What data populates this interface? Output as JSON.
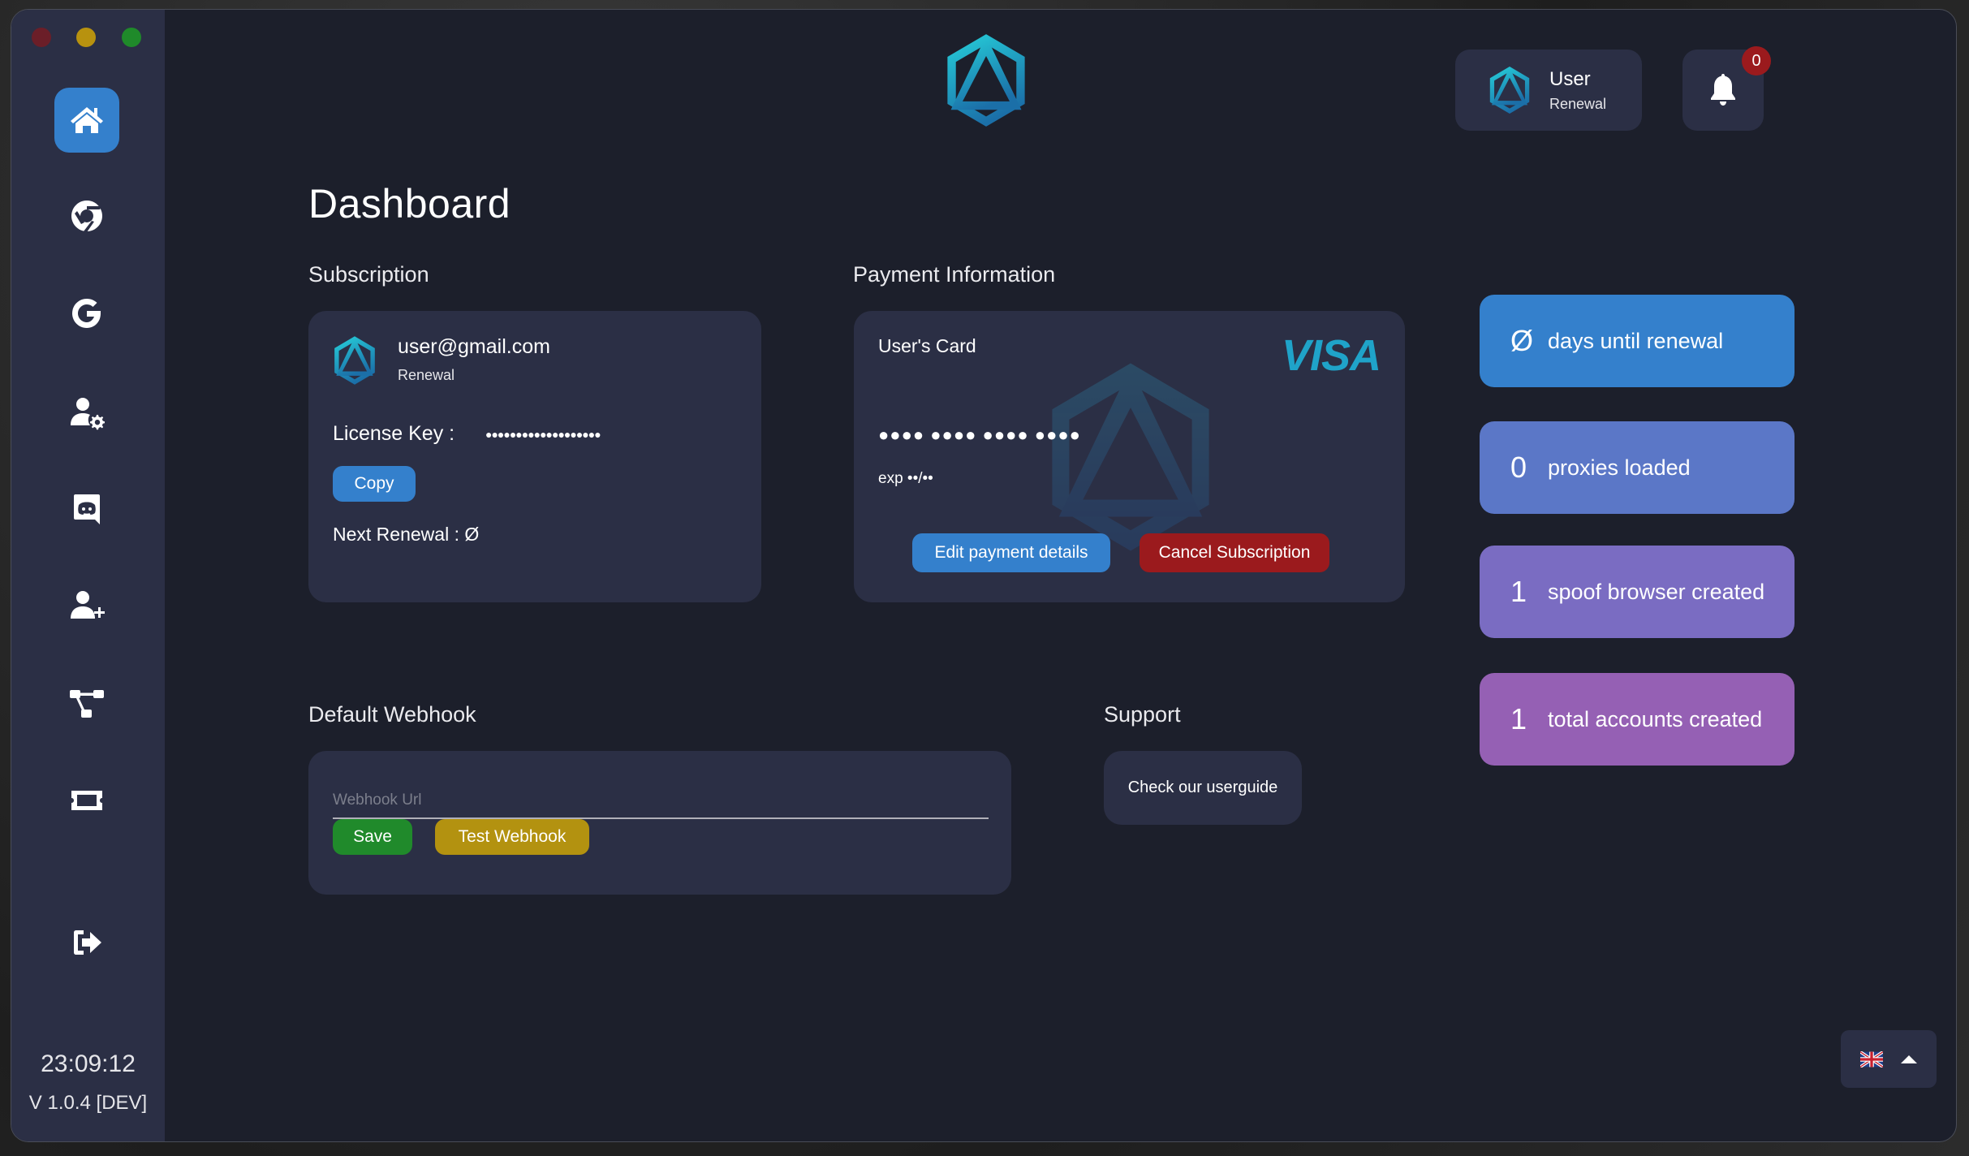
{
  "window": {
    "controls": [
      "close",
      "minimize",
      "maximize"
    ]
  },
  "sidebar": {
    "items": [
      {
        "id": "home",
        "icon": "home-icon",
        "active": true
      },
      {
        "id": "browser",
        "icon": "chrome-icon",
        "active": false
      },
      {
        "id": "google",
        "icon": "google-icon",
        "active": false
      },
      {
        "id": "account-settings",
        "icon": "user-gear-icon",
        "active": false
      },
      {
        "id": "discord",
        "icon": "discord-icon",
        "active": false
      },
      {
        "id": "add-user",
        "icon": "user-plus-icon",
        "active": false
      },
      {
        "id": "workflow",
        "icon": "sitemap-icon",
        "active": false
      },
      {
        "id": "ticket",
        "icon": "ticket-icon",
        "active": false
      },
      {
        "id": "logout",
        "icon": "logout-icon",
        "active": false
      }
    ],
    "time": "23:09:12",
    "version": "V 1.0.4 [DEV]"
  },
  "header": {
    "user": {
      "name": "User",
      "plan": "Renewal"
    },
    "notifications": {
      "count": "0"
    }
  },
  "page": {
    "title": "Dashboard"
  },
  "subscription": {
    "label": "Subscription",
    "email": "user@gmail.com",
    "plan": "Renewal",
    "license_label": "License Key :",
    "license_value": "●●●●●●●●●●●●●●●●●●●",
    "copy_label": "Copy",
    "next_renewal": "Next Renewal : Ø"
  },
  "payment": {
    "label": "Payment Information",
    "card_title": "User's Card",
    "brand": "VISA",
    "card_number": "●●●● ●●●● ●●●● ●●●●",
    "exp": "exp ••/••",
    "edit_label": "Edit payment details",
    "cancel_label": "Cancel Subscription"
  },
  "stats": [
    {
      "value": "Ø",
      "label": "days until renewal",
      "color": "#3480cc"
    },
    {
      "value": "0",
      "label": "proxies loaded",
      "color": "#5b77c7"
    },
    {
      "value": "1",
      "label": "spoof browser created",
      "color": "#7a6cc2"
    },
    {
      "value": "1",
      "label": "total accounts created",
      "color": "#9560b4"
    }
  ],
  "webhook": {
    "label": "Default Webhook",
    "placeholder": "Webhook Url",
    "value": "",
    "save_label": "Save",
    "test_label": "Test Webhook"
  },
  "support": {
    "label": "Support",
    "link_label": "Check our userguide"
  },
  "language": {
    "selected": "en-GB",
    "icon": "uk-flag-icon"
  },
  "colors": {
    "accent": "#3480cc",
    "danger": "#9b1a1d",
    "success": "#208a2b",
    "warning": "#b39210",
    "sidebar_bg": "#2b2f45",
    "main_bg": "#1c1f2b",
    "brand_teal": "#24c6d6"
  }
}
